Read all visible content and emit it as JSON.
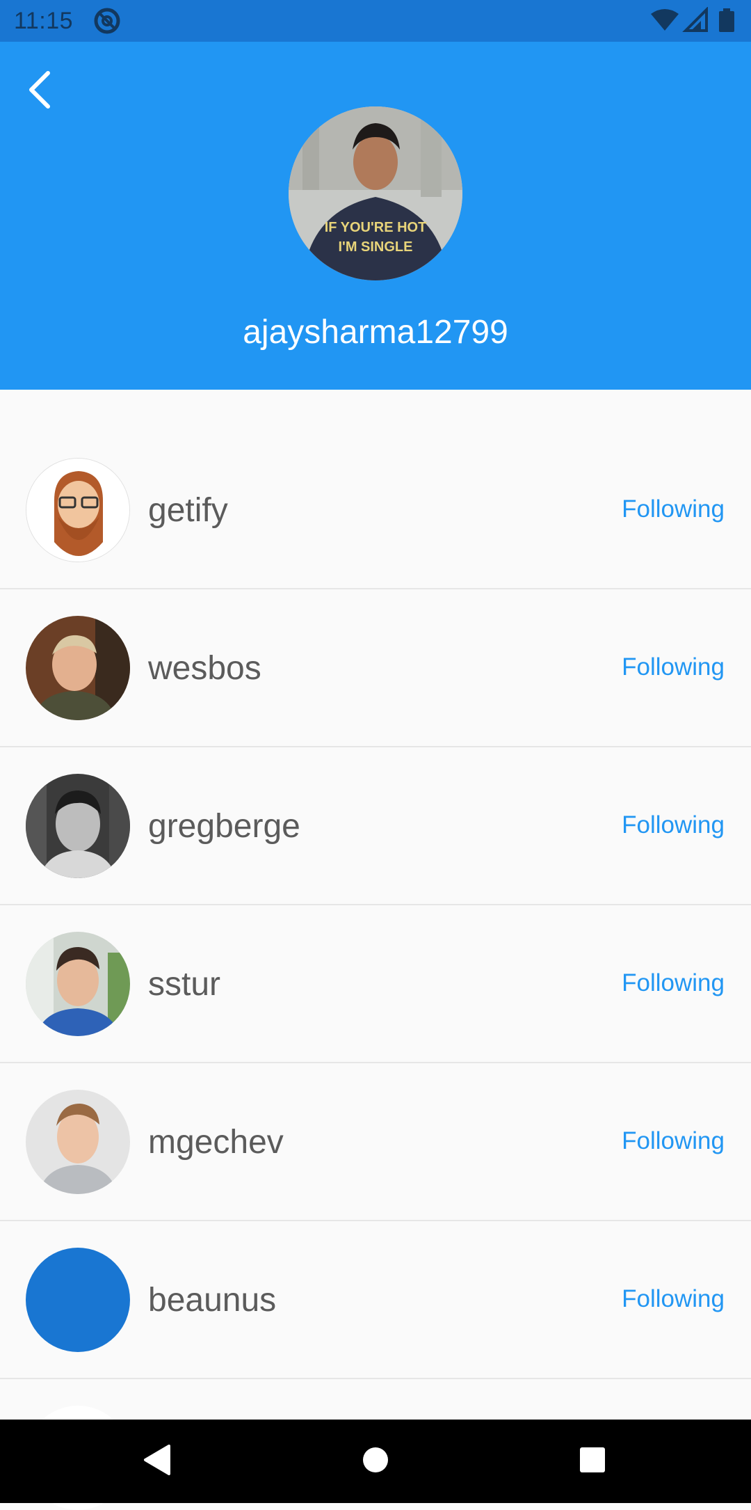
{
  "status_bar": {
    "time": "11:15",
    "app_icon": "at-sign-icon",
    "right_icons": [
      "wifi-icon",
      "signal-icon",
      "battery-icon"
    ]
  },
  "header": {
    "back_icon": "chevron-left-icon",
    "username": "ajaysharma12799",
    "background_color": "#2196f3"
  },
  "following": [
    {
      "username": "getify",
      "action": "Following"
    },
    {
      "username": "wesbos",
      "action": "Following"
    },
    {
      "username": "gregberge",
      "action": "Following"
    },
    {
      "username": "sstur",
      "action": "Following"
    },
    {
      "username": "mgechev",
      "action": "Following"
    },
    {
      "username": "beaunus",
      "action": "Following"
    }
  ],
  "nav_bar": {
    "icons": [
      "back-triangle-icon",
      "home-circle-icon",
      "recents-square-icon"
    ]
  },
  "colors": {
    "accent": "#2196f3",
    "status_bar": "#1976d2",
    "list_text": "#5b5b5b"
  }
}
